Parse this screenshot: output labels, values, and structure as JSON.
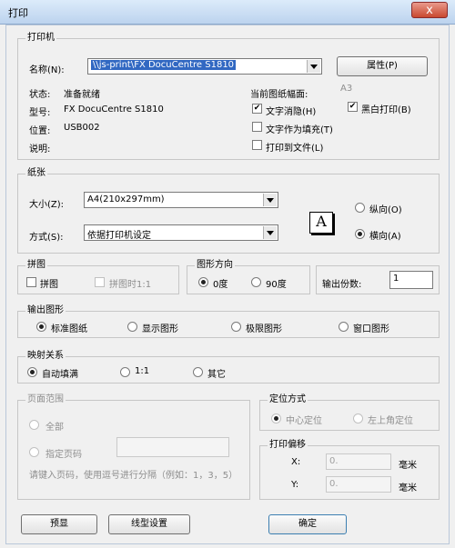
{
  "window": {
    "title": "打印",
    "close": "x"
  },
  "printer": {
    "legend": "打印机",
    "name_label": "名称(N):",
    "name_value": "\\\\js-print\\FX DocuCentre S1810",
    "properties_button": "属性(P)",
    "status_label": "状态:",
    "status_value": "准备就绪",
    "model_label": "型号:",
    "model_value": "FX DocuCentre S1810",
    "location_label": "位置:",
    "location_value": "USB002",
    "comment_label": "说明:",
    "current_size_label": "当前图纸幅面:",
    "current_size_value": "A3",
    "opt_text_antialias": "文字消隐(H)",
    "opt_text_as_fill": "文字作为填充(T)",
    "opt_print_to_file": "打印到文件(L)",
    "opt_black_white": "黑白打印(B)"
  },
  "paper": {
    "legend": "纸张",
    "size_label": "大小(Z):",
    "size_value": "A4(210x297mm)",
    "method_label": "方式(S):",
    "method_value": "依据打印机设定",
    "portrait": "纵向(O)",
    "landscape": "横向(A)",
    "orientation_glyph": "A"
  },
  "tile": {
    "legend": "拼图",
    "tile": "拼图",
    "tile_1_1": "拼图时1:1"
  },
  "rotation": {
    "legend": "图形方向",
    "deg0": "0度",
    "deg90": "90度"
  },
  "copies": {
    "label": "输出份数:",
    "value": "1"
  },
  "output": {
    "legend": "输出图形",
    "standard": "标准图纸",
    "display": "显示图形",
    "limits": "极限图形",
    "window": "窗口图形"
  },
  "mapping": {
    "legend": "映射关系",
    "auto_fill": "自动填满",
    "one_one": "1:1",
    "other": "其它"
  },
  "page_range": {
    "legend": "页面范围",
    "all": "全部",
    "specify": "指定页码",
    "hint": "请键入页码，使用逗号进行分隔（例如：1，3，5）"
  },
  "position": {
    "legend": "定位方式",
    "center": "中心定位",
    "top_left": "左上角定位"
  },
  "offset": {
    "legend": "打印偏移",
    "x_label": "X:",
    "x_value": "0.",
    "y_label": "Y:",
    "y_value": "0.",
    "unit": "毫米"
  },
  "buttons": {
    "preview": "预显",
    "line_settings": "线型设置",
    "ok": "确定"
  }
}
